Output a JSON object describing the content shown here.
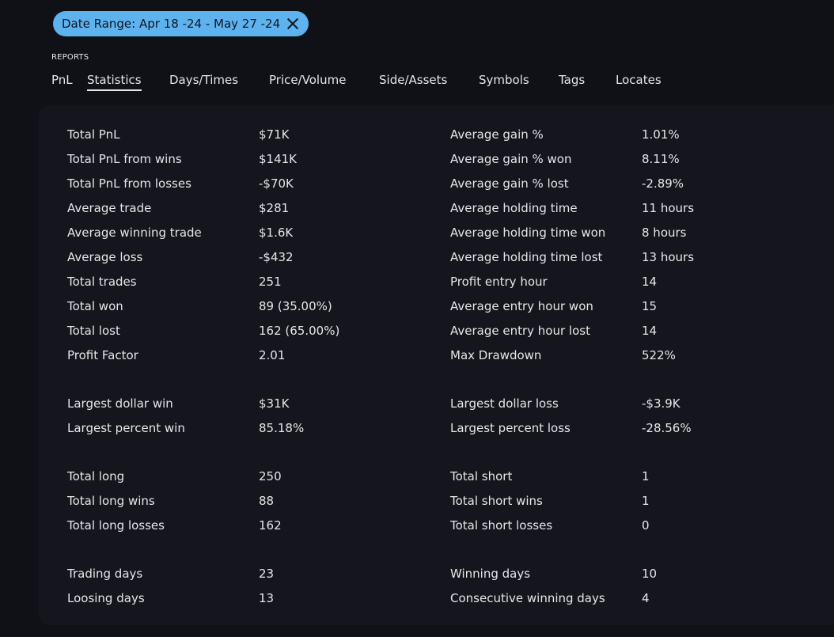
{
  "filter": {
    "chip_label": "Date Range: Apr 18 -24 - May 27 -24"
  },
  "reports": {
    "label": "REPORTS",
    "tabs": [
      "PnL",
      "Statistics",
      "Days/Times",
      "Price/Volume",
      "Side/Assets",
      "Symbols",
      "Tags",
      "Locates"
    ],
    "active_tab": "Statistics"
  },
  "stats": {
    "left": [
      {
        "label": "Total PnL",
        "value": "$71K"
      },
      {
        "label": "Total PnL from wins",
        "value": "$141K"
      },
      {
        "label": "Total PnL from losses",
        "value": "-$70K"
      },
      {
        "label": "Average trade",
        "value": "$281"
      },
      {
        "label": "Average winning trade",
        "value": "$1.6K"
      },
      {
        "label": "Average loss",
        "value": "-$432"
      },
      {
        "label": "Total trades",
        "value": "251"
      },
      {
        "label": "Total won",
        "value": "89 (35.00%)"
      },
      {
        "label": "Total lost",
        "value": "162 (65.00%)"
      },
      {
        "label": "Profit Factor",
        "value": "2.01"
      },
      {
        "label": "Largest dollar win",
        "value": "$31K"
      },
      {
        "label": "Largest percent win",
        "value": "85.18%"
      },
      {
        "label": "Total long",
        "value": "250"
      },
      {
        "label": "Total long wins",
        "value": "88"
      },
      {
        "label": "Total long losses",
        "value": "162"
      },
      {
        "label": "Trading days",
        "value": "23"
      },
      {
        "label": "Loosing days",
        "value": "13"
      }
    ],
    "right": [
      {
        "label": "Average gain %",
        "value": "1.01%"
      },
      {
        "label": "Average gain % won",
        "value": "8.11%"
      },
      {
        "label": "Average gain % lost",
        "value": "-2.89%"
      },
      {
        "label": "Average holding time",
        "value": "11 hours"
      },
      {
        "label": "Average holding time won",
        "value": "8 hours"
      },
      {
        "label": "Average holding time lost",
        "value": "13 hours"
      },
      {
        "label": "Profit entry hour",
        "value": "14"
      },
      {
        "label": "Average entry hour won",
        "value": "15"
      },
      {
        "label": "Average entry hour lost",
        "value": "14"
      },
      {
        "label": "Max Drawdown",
        "value": "522%"
      },
      {
        "label": "Largest dollar loss",
        "value": "-$3.9K"
      },
      {
        "label": "Largest percent loss",
        "value": "-28.56%"
      },
      {
        "label": "Total short",
        "value": "1"
      },
      {
        "label": "Total short wins",
        "value": "1"
      },
      {
        "label": "Total short losses",
        "value": "0"
      },
      {
        "label": "Winning days",
        "value": "10"
      },
      {
        "label": "Consecutive winning days",
        "value": "4"
      }
    ]
  },
  "colors": {
    "background": "#101117",
    "panel": "#15161d",
    "chip": "#5eb3ef",
    "text": "#e6e6e6"
  }
}
